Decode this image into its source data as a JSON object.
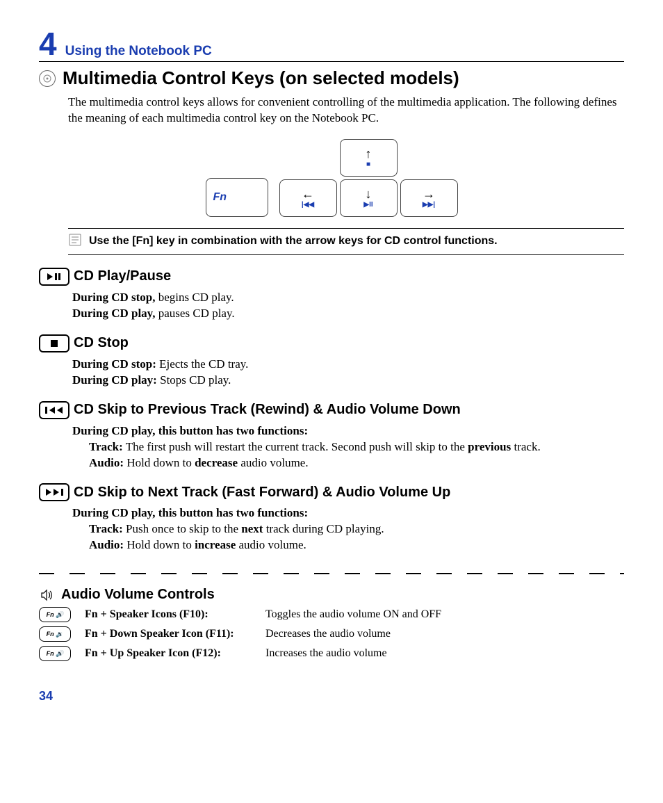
{
  "chapter": {
    "number": "4",
    "title": "Using the Notebook PC"
  },
  "section": {
    "title": "Multimedia Control Keys (on selected models)",
    "intro": "The multimedia control keys allows for convenient controlling of the multimedia application. The following defines the meaning of each multimedia control key on the Notebook PC."
  },
  "keys": {
    "fn": "Fn",
    "up_media": "■",
    "left_media": "|◀◀",
    "down_media": "▶II",
    "right_media": "▶▶|"
  },
  "note": "Use the [Fn] key in combination with the arrow keys for CD control functions.",
  "subsections": {
    "playpause": {
      "title": "CD Play/Pause",
      "l1a": "During CD stop,",
      "l1b": " begins CD play.",
      "l2a": "During CD play,",
      "l2b": " pauses CD play."
    },
    "stop": {
      "title": "CD Stop",
      "l1a": "During CD stop:",
      "l1b": " Ejects the CD tray.",
      "l2a": "During CD play:",
      "l2b": " Stops CD play."
    },
    "prev": {
      "title": "CD Skip to Previous Track (Rewind) & Audio Volume Down",
      "lead": "During CD play, this button has two functions:",
      "track_label": "Track:",
      "track_a": " The first push will restart the current track. Second push will skip to the ",
      "track_b": "previous",
      "track_c": " track.",
      "audio_label": "Audio:",
      "audio_a": " Hold down to ",
      "audio_b": "decrease",
      "audio_c": " audio volume."
    },
    "next": {
      "title": "CD Skip to Next Track (Fast Forward) & Audio Volume Up",
      "lead": "During CD play, this button has two functions:",
      "track_label": "Track:",
      "track_a": " Push once to skip to the ",
      "track_b": "next",
      "track_c": " track during CD playing.",
      "audio_label": "Audio:",
      "audio_a": " Hold down to ",
      "audio_b": "increase",
      "audio_c": " audio volume."
    }
  },
  "audio_controls": {
    "title": "Audio Volume Controls",
    "rows": [
      {
        "icon": "Fn 🔊",
        "label": "Fn + Speaker Icons (F10):",
        "desc": "Toggles the audio volume ON and OFF"
      },
      {
        "icon": "Fn 🔉",
        "label": "Fn + Down Speaker Icon (F11):",
        "desc": "Decreases the audio volume"
      },
      {
        "icon": "Fn 🔊",
        "label": "Fn + Up Speaker Icon (F12):",
        "desc": "Increases the audio volume"
      }
    ]
  },
  "page_number": "34"
}
